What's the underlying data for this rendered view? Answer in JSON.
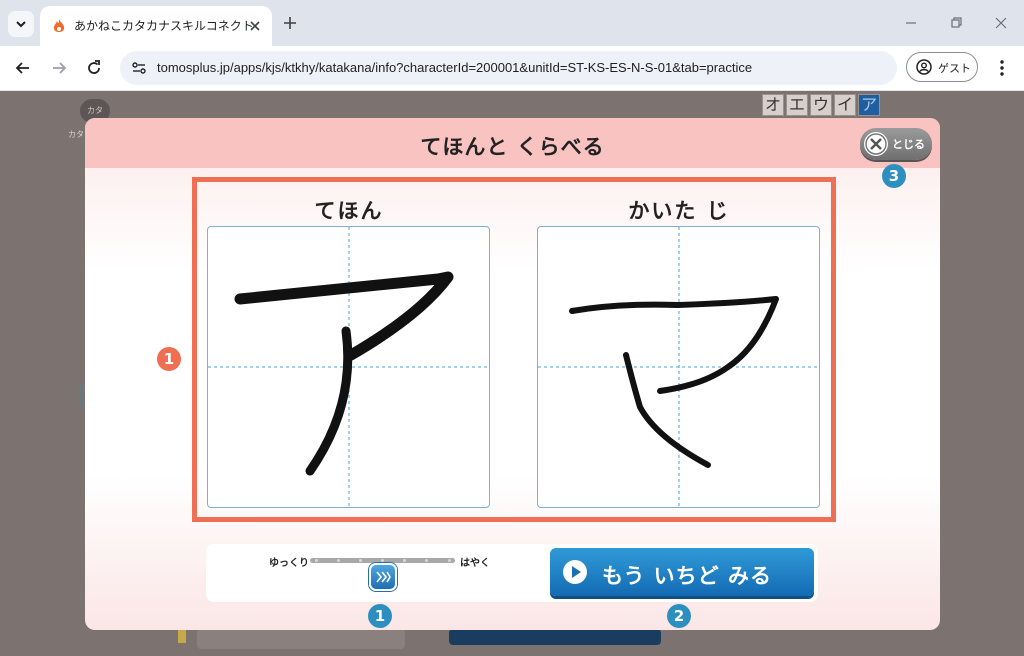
{
  "browser": {
    "tab_title": "あかねこカタカナスキルコネクト",
    "url": "tomosplus.jp/apps/kjs/ktkhy/katakana/info?characterId=200001&unitId=ST-KS-ES-N-S-01&tab=practice",
    "profile_label": "ゲスト",
    "icons": [
      "tab-list-icon",
      "favicon-icon",
      "close-icon",
      "plus-icon",
      "minimize-icon",
      "restore-icon",
      "close-window-icon",
      "back-icon",
      "forward-icon",
      "reload-icon",
      "site-info-icon",
      "profile-icon",
      "more-icon"
    ]
  },
  "background": {
    "chip_label": "カタ",
    "chip_sub": "カタ",
    "kana_tabs": [
      "オ",
      "エ",
      "ウ",
      "イ",
      "ア"
    ],
    "active_kana": "ア"
  },
  "modal": {
    "title": "てほんと くらべる",
    "close_label": "とじる",
    "close_badge": "3",
    "frame_badge": "1",
    "model_label": "てほん",
    "written_label": "かいた じ",
    "speed_slow": "ゆっくり",
    "speed_fast": "はやく",
    "speed_level": 4,
    "speed_steps": 7,
    "speed_badge": "1",
    "replay_label": "もう いちど みる",
    "replay_badge": "2"
  },
  "colors": {
    "accent_blue": "#1f78c1",
    "frame_orange": "#ef6f55",
    "header_pink": "#f8c3c1",
    "badge_blue": "#2d8fbf"
  }
}
